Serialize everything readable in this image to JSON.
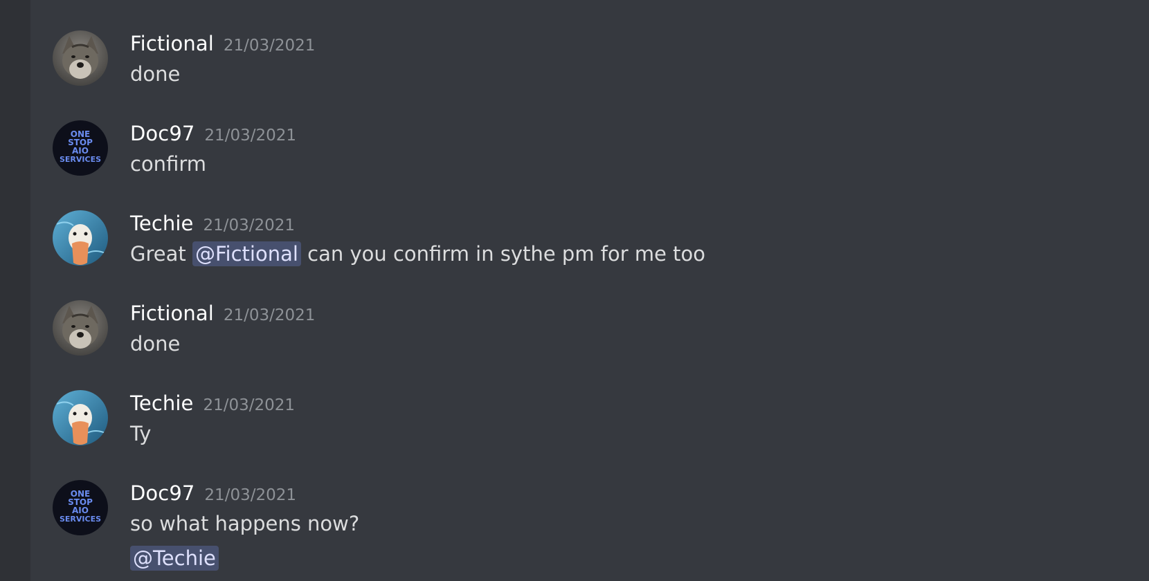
{
  "messages": [
    {
      "author": "Fictional",
      "timestamp": "21/03/2021",
      "avatar": "wolf-avatar",
      "parts": {
        "before": "",
        "mention": "",
        "after": "done"
      }
    },
    {
      "author": "Doc97",
      "timestamp": "21/03/2021",
      "avatar": "one-stop-aio-logo",
      "parts": {
        "before": "",
        "mention": "",
        "after": "confirm"
      }
    },
    {
      "author": "Techie",
      "timestamp": "21/03/2021",
      "avatar": "duck-avatar",
      "parts": {
        "before": "Great ",
        "mention": "@Fictional",
        "after": " can you confirm in sythe pm for me too"
      }
    },
    {
      "author": "Fictional",
      "timestamp": "21/03/2021",
      "avatar": "wolf-avatar",
      "parts": {
        "before": "",
        "mention": "",
        "after": "done"
      }
    },
    {
      "author": "Techie",
      "timestamp": "21/03/2021",
      "avatar": "duck-avatar",
      "parts": {
        "before": "",
        "mention": "",
        "after": "Ty"
      }
    },
    {
      "author": "Doc97",
      "timestamp": "21/03/2021",
      "avatar": "one-stop-aio-logo",
      "parts": {
        "before": "",
        "mention": "",
        "after": "so what happens now?"
      },
      "second_line_mention": "@Techie"
    }
  ],
  "logo_text": [
    "ONE",
    "STOP",
    "AIO",
    "SERVICES"
  ],
  "colors": {
    "background": "#36393f",
    "side_strip": "#2f3136",
    "username": "#ffffff",
    "timestamp": "#8e9297",
    "message_text": "#dcddde",
    "mention_bg": "#4a5080",
    "mention_text": "#dee0fc"
  }
}
